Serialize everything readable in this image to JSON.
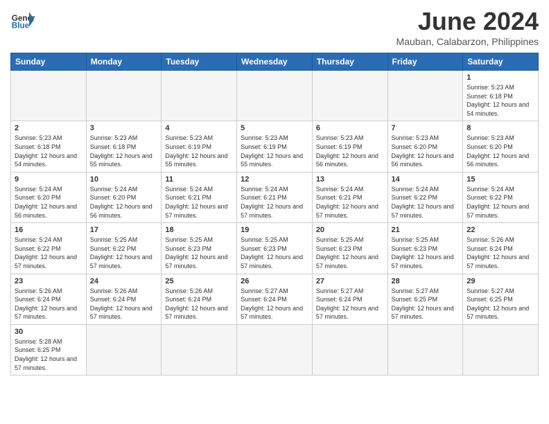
{
  "header": {
    "logo_general": "General",
    "logo_blue": "Blue",
    "month_title": "June 2024",
    "subtitle": "Mauban, Calabarzon, Philippines"
  },
  "weekdays": [
    "Sunday",
    "Monday",
    "Tuesday",
    "Wednesday",
    "Thursday",
    "Friday",
    "Saturday"
  ],
  "weeks": [
    [
      {
        "day": "",
        "info": ""
      },
      {
        "day": "",
        "info": ""
      },
      {
        "day": "",
        "info": ""
      },
      {
        "day": "",
        "info": ""
      },
      {
        "day": "",
        "info": ""
      },
      {
        "day": "",
        "info": ""
      },
      {
        "day": "1",
        "info": "Sunrise: 5:23 AM\nSunset: 6:18 PM\nDaylight: 12 hours and 54 minutes."
      }
    ],
    [
      {
        "day": "2",
        "info": "Sunrise: 5:23 AM\nSunset: 6:18 PM\nDaylight: 12 hours and 54 minutes."
      },
      {
        "day": "3",
        "info": "Sunrise: 5:23 AM\nSunset: 6:18 PM\nDaylight: 12 hours and 55 minutes."
      },
      {
        "day": "4",
        "info": "Sunrise: 5:23 AM\nSunset: 6:19 PM\nDaylight: 12 hours and 55 minutes."
      },
      {
        "day": "5",
        "info": "Sunrise: 5:23 AM\nSunset: 6:19 PM\nDaylight: 12 hours and 55 minutes."
      },
      {
        "day": "6",
        "info": "Sunrise: 5:23 AM\nSunset: 6:19 PM\nDaylight: 12 hours and 56 minutes."
      },
      {
        "day": "7",
        "info": "Sunrise: 5:23 AM\nSunset: 6:20 PM\nDaylight: 12 hours and 56 minutes."
      },
      {
        "day": "8",
        "info": "Sunrise: 5:23 AM\nSunset: 6:20 PM\nDaylight: 12 hours and 56 minutes."
      }
    ],
    [
      {
        "day": "9",
        "info": "Sunrise: 5:24 AM\nSunset: 6:20 PM\nDaylight: 12 hours and 56 minutes."
      },
      {
        "day": "10",
        "info": "Sunrise: 5:24 AM\nSunset: 6:20 PM\nDaylight: 12 hours and 56 minutes."
      },
      {
        "day": "11",
        "info": "Sunrise: 5:24 AM\nSunset: 6:21 PM\nDaylight: 12 hours and 57 minutes."
      },
      {
        "day": "12",
        "info": "Sunrise: 5:24 AM\nSunset: 6:21 PM\nDaylight: 12 hours and 57 minutes."
      },
      {
        "day": "13",
        "info": "Sunrise: 5:24 AM\nSunset: 6:21 PM\nDaylight: 12 hours and 57 minutes."
      },
      {
        "day": "14",
        "info": "Sunrise: 5:24 AM\nSunset: 6:22 PM\nDaylight: 12 hours and 57 minutes."
      },
      {
        "day": "15",
        "info": "Sunrise: 5:24 AM\nSunset: 6:22 PM\nDaylight: 12 hours and 57 minutes."
      }
    ],
    [
      {
        "day": "16",
        "info": "Sunrise: 5:24 AM\nSunset: 6:22 PM\nDaylight: 12 hours and 57 minutes."
      },
      {
        "day": "17",
        "info": "Sunrise: 5:25 AM\nSunset: 6:22 PM\nDaylight: 12 hours and 57 minutes."
      },
      {
        "day": "18",
        "info": "Sunrise: 5:25 AM\nSunset: 6:23 PM\nDaylight: 12 hours and 57 minutes."
      },
      {
        "day": "19",
        "info": "Sunrise: 5:25 AM\nSunset: 6:23 PM\nDaylight: 12 hours and 57 minutes."
      },
      {
        "day": "20",
        "info": "Sunrise: 5:25 AM\nSunset: 6:23 PM\nDaylight: 12 hours and 57 minutes."
      },
      {
        "day": "21",
        "info": "Sunrise: 5:25 AM\nSunset: 6:23 PM\nDaylight: 12 hours and 57 minutes."
      },
      {
        "day": "22",
        "info": "Sunrise: 5:26 AM\nSunset: 6:24 PM\nDaylight: 12 hours and 57 minutes."
      }
    ],
    [
      {
        "day": "23",
        "info": "Sunrise: 5:26 AM\nSunset: 6:24 PM\nDaylight: 12 hours and 57 minutes."
      },
      {
        "day": "24",
        "info": "Sunrise: 5:26 AM\nSunset: 6:24 PM\nDaylight: 12 hours and 57 minutes."
      },
      {
        "day": "25",
        "info": "Sunrise: 5:26 AM\nSunset: 6:24 PM\nDaylight: 12 hours and 57 minutes."
      },
      {
        "day": "26",
        "info": "Sunrise: 5:27 AM\nSunset: 6:24 PM\nDaylight: 12 hours and 57 minutes."
      },
      {
        "day": "27",
        "info": "Sunrise: 5:27 AM\nSunset: 6:24 PM\nDaylight: 12 hours and 57 minutes."
      },
      {
        "day": "28",
        "info": "Sunrise: 5:27 AM\nSunset: 6:25 PM\nDaylight: 12 hours and 57 minutes."
      },
      {
        "day": "29",
        "info": "Sunrise: 5:27 AM\nSunset: 6:25 PM\nDaylight: 12 hours and 57 minutes."
      }
    ],
    [
      {
        "day": "30",
        "info": "Sunrise: 5:28 AM\nSunset: 6:25 PM\nDaylight: 12 hours and 57 minutes."
      },
      {
        "day": "",
        "info": ""
      },
      {
        "day": "",
        "info": ""
      },
      {
        "day": "",
        "info": ""
      },
      {
        "day": "",
        "info": ""
      },
      {
        "day": "",
        "info": ""
      },
      {
        "day": "",
        "info": ""
      }
    ]
  ]
}
